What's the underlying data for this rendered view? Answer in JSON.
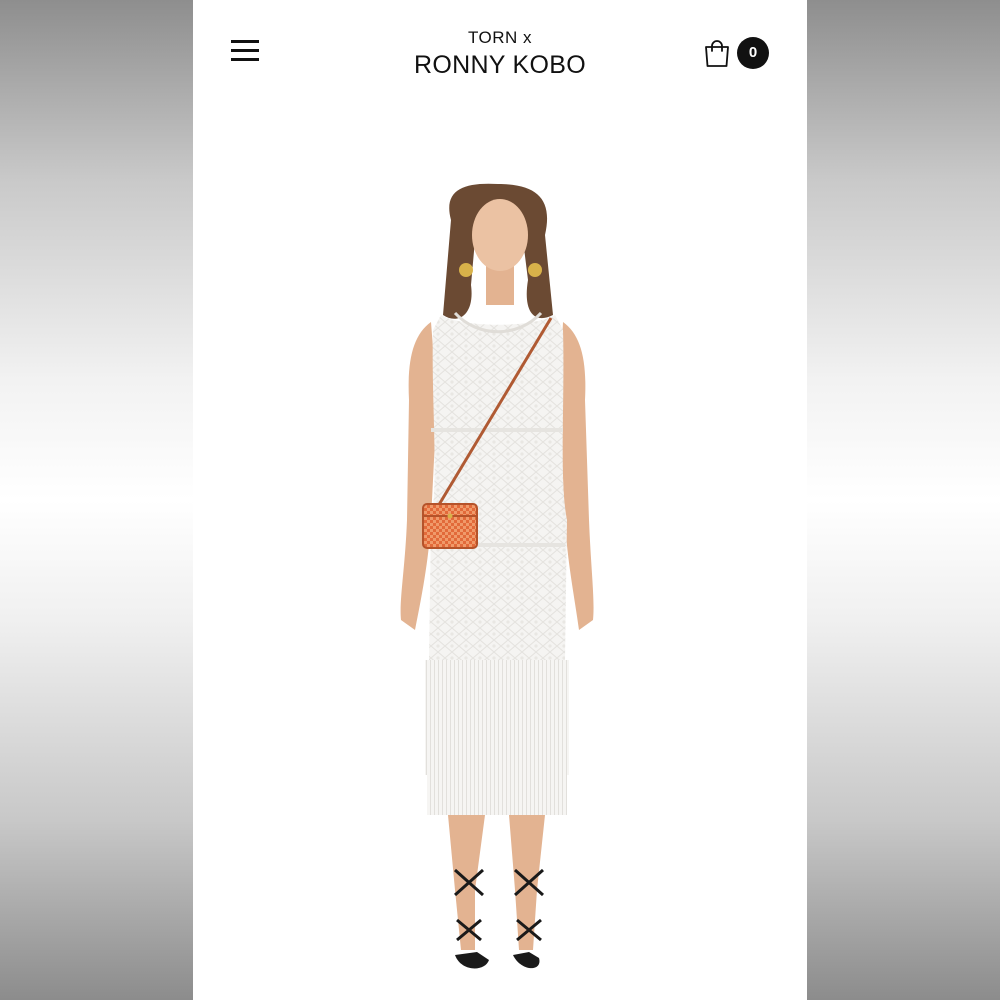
{
  "header": {
    "logo_line1": "TORN x",
    "logo_line2": "RONNY KOBO",
    "cart_count": "0"
  },
  "icons": {
    "menu": "hamburger-menu-icon",
    "cart": "shopping-bag-icon"
  },
  "product_image": {
    "alt": "Model wearing white sleeveless crochet fringe midi dress with orange mini crossbody bag",
    "colors": {
      "dress": "#f5f4f2",
      "bag": "#e26a3a",
      "hair": "#6b4a33",
      "skin": "#e6b999",
      "sandals": "#1a1a1a"
    }
  },
  "colors": {
    "text": "#111111",
    "background": "#ffffff",
    "badge_bg": "#111111",
    "badge_text": "#ffffff"
  }
}
